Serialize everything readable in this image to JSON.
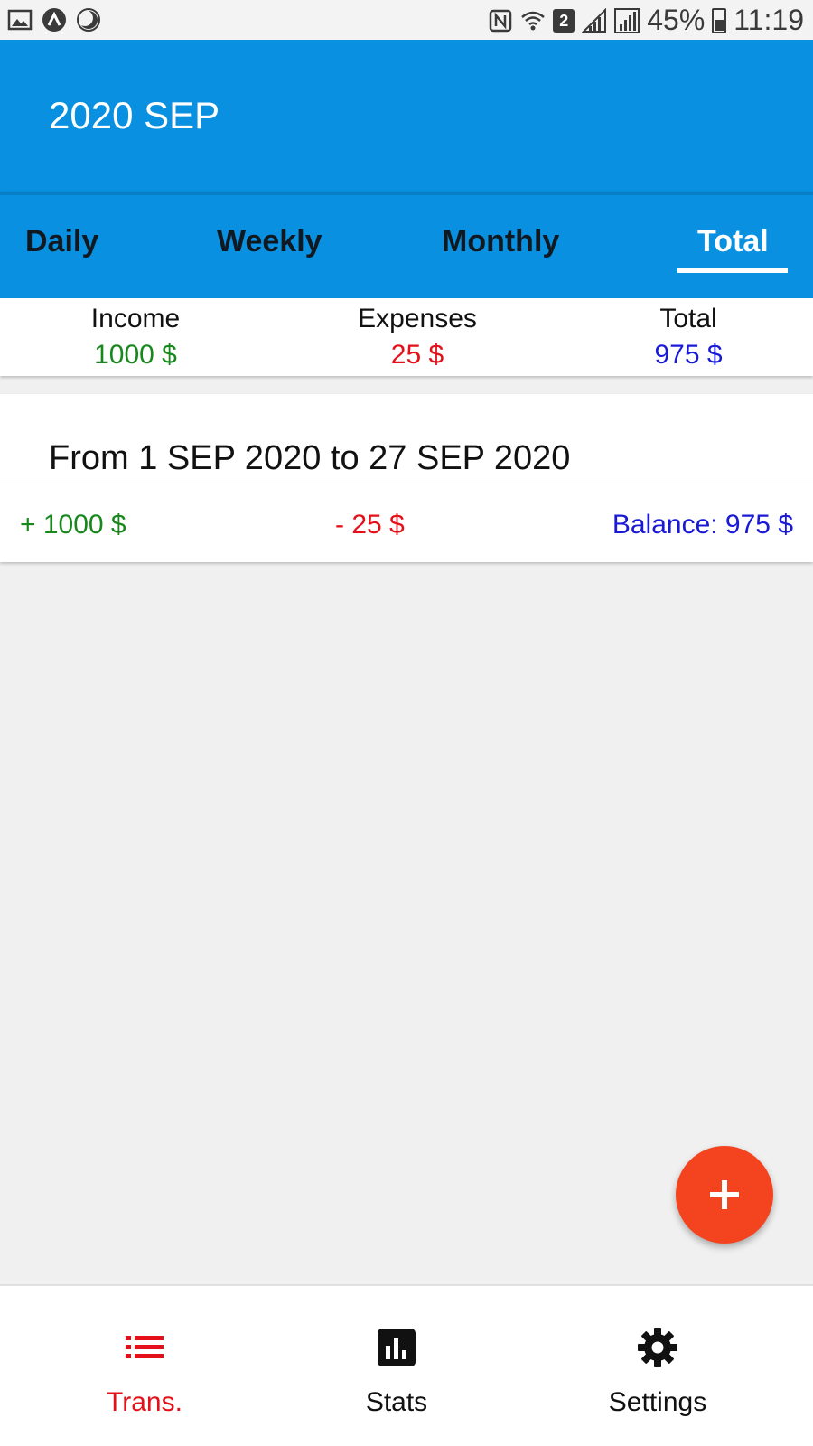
{
  "status_bar": {
    "battery": "45%",
    "time": "11:19",
    "sim_badge": "2"
  },
  "app_bar": {
    "title": "2020 SEP"
  },
  "tabs": [
    {
      "label": "Daily",
      "active": false
    },
    {
      "label": "Weekly",
      "active": false
    },
    {
      "label": "Monthly",
      "active": false
    },
    {
      "label": "Total",
      "active": true
    }
  ],
  "summary": {
    "income_label": "Income",
    "income_value": "1000 $",
    "expenses_label": "Expenses",
    "expenses_value": "25 $",
    "total_label": "Total",
    "total_value": "975 $"
  },
  "period_card": {
    "title": "From 1 SEP 2020 to 27 SEP 2020",
    "income": "+ 1000 $",
    "expense": "- 25 $",
    "balance": "Balance: 975 $"
  },
  "fab": {
    "icon": "plus-icon",
    "color": "#f4441f"
  },
  "bottom_nav": [
    {
      "label": "Trans.",
      "icon": "list-icon",
      "active": true
    },
    {
      "label": "Stats",
      "icon": "bar-chart-icon",
      "active": false
    },
    {
      "label": "Settings",
      "icon": "gear-icon",
      "active": false
    }
  ],
  "colors": {
    "primary": "#0990e1",
    "income": "#18881c",
    "expense": "#e3101a",
    "balance": "#1a1ad6",
    "active_nav": "#e3101a"
  }
}
